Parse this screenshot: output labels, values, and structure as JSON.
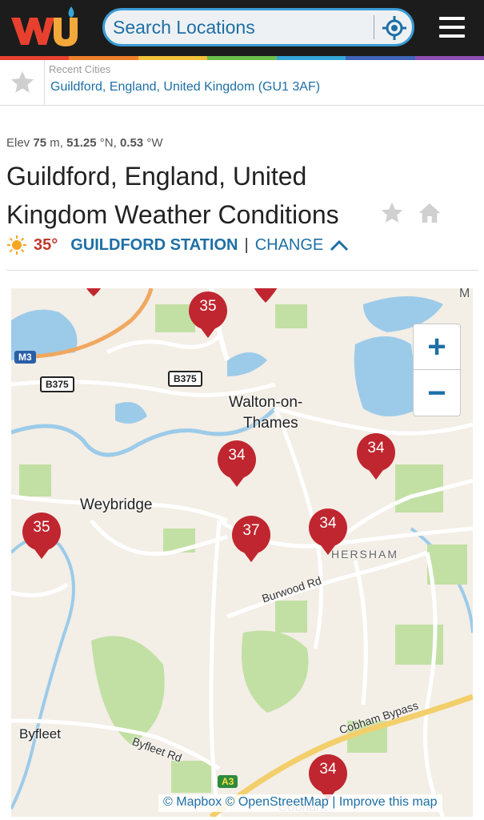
{
  "header": {
    "logo_icon": "wu-logo-icon",
    "search_placeholder": "Search Locations",
    "locate_icon": "crosshair-icon",
    "menu_icon": "hamburger-menu-icon",
    "rainbow": [
      "#e8402f",
      "#f07f2a",
      "#f3c13a",
      "#6bbf4a",
      "#35a6d9",
      "#3f64b9",
      "#8e4fb3"
    ]
  },
  "recent": {
    "label": "Recent Cities",
    "city": "Guildford, England, United Kingdom (GU1 3AF)"
  },
  "location": {
    "elev_label": "Elev",
    "elev_value": "75",
    "elev_unit": "m,",
    "lat_value": "51.25",
    "lat_unit": "°N,",
    "lon_value": "0.53",
    "lon_unit": "°W",
    "title": "Guildford, England, United Kingdom Weather Conditions",
    "temperature": "35°",
    "station": "GUILDFORD STATION",
    "separator": "|",
    "change": "CHANGE"
  },
  "map": {
    "zoom_in": "+",
    "zoom_out": "−",
    "places": [
      "Walton-on-",
      "Thames",
      "Weybridge",
      "Byfleet",
      "HERSHAM",
      "Cobham",
      "M"
    ],
    "roads": [
      "B375",
      "B375",
      "M3",
      "A3",
      "Burwood Rd",
      "Cobham Bypass",
      "Byfleet Rd"
    ],
    "pins": [
      "35",
      "34",
      "34",
      "35",
      "37",
      "34",
      "34"
    ],
    "attribution": "© Mapbox © OpenStreetMap | Improve this map"
  },
  "colors": {
    "accent": "#1d6fa5",
    "pin": "#c0262f",
    "temp": "#c0392b",
    "header_bg": "#1c1c1c"
  }
}
